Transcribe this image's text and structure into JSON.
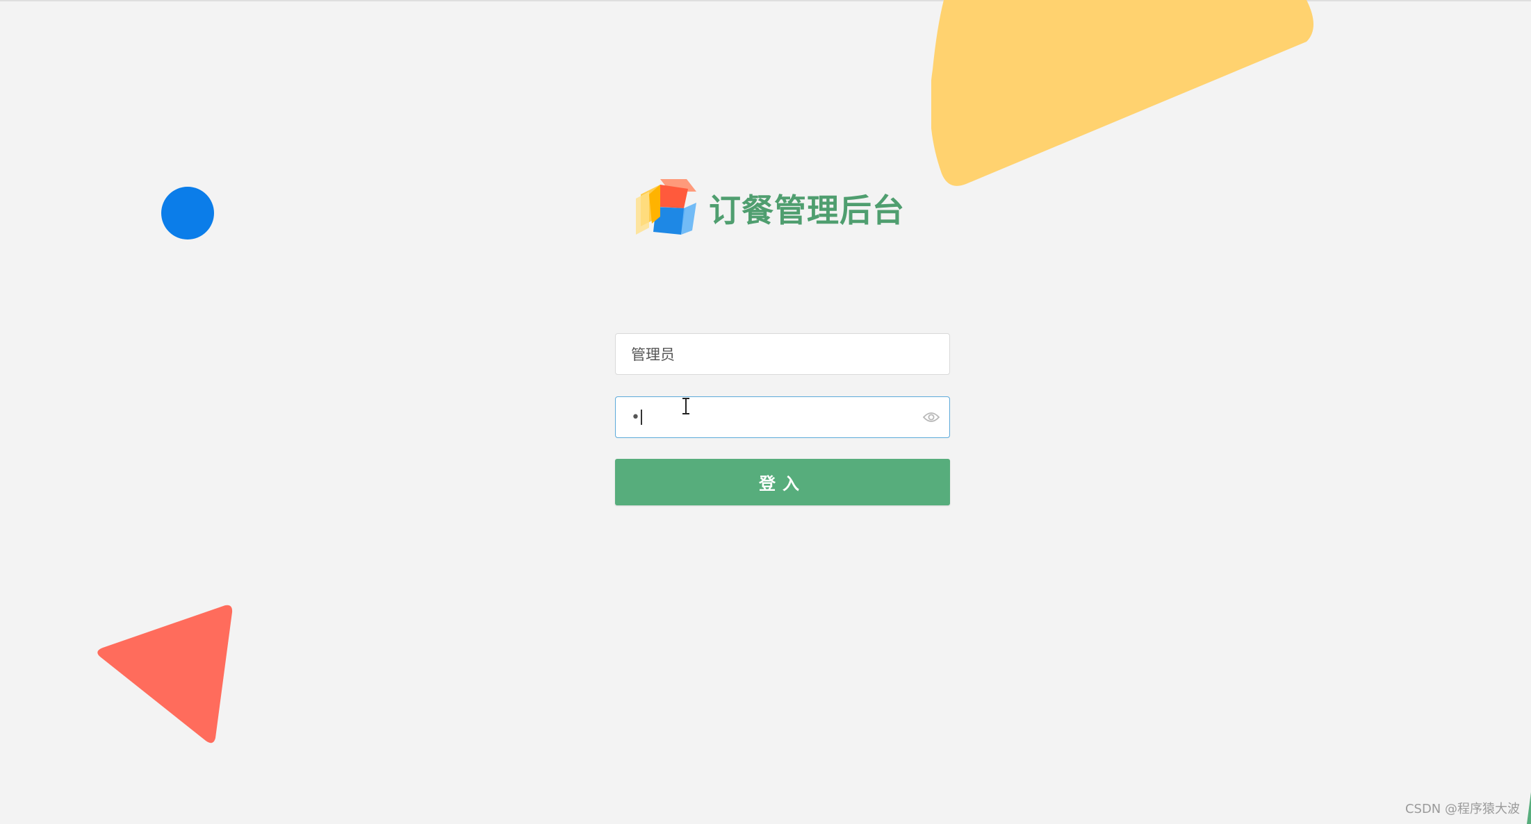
{
  "brand": {
    "logo_icon": "cube-logo",
    "title": "订餐管理后台"
  },
  "login": {
    "username_value": "管理员",
    "password_value": "•",
    "password_visibility_icon": "eye-icon",
    "submit_label": "登入"
  },
  "watermark": "CSDN @程序猿大波",
  "colors": {
    "background": "#f3f3f3",
    "accent_green": "#57ad7c",
    "title_green": "#4f9e6f",
    "focus_blue": "#5ba9d9",
    "decor_yellow": "#ffd26f",
    "decor_blue": "#0b7de9",
    "decor_red": "#ff6c5c"
  }
}
